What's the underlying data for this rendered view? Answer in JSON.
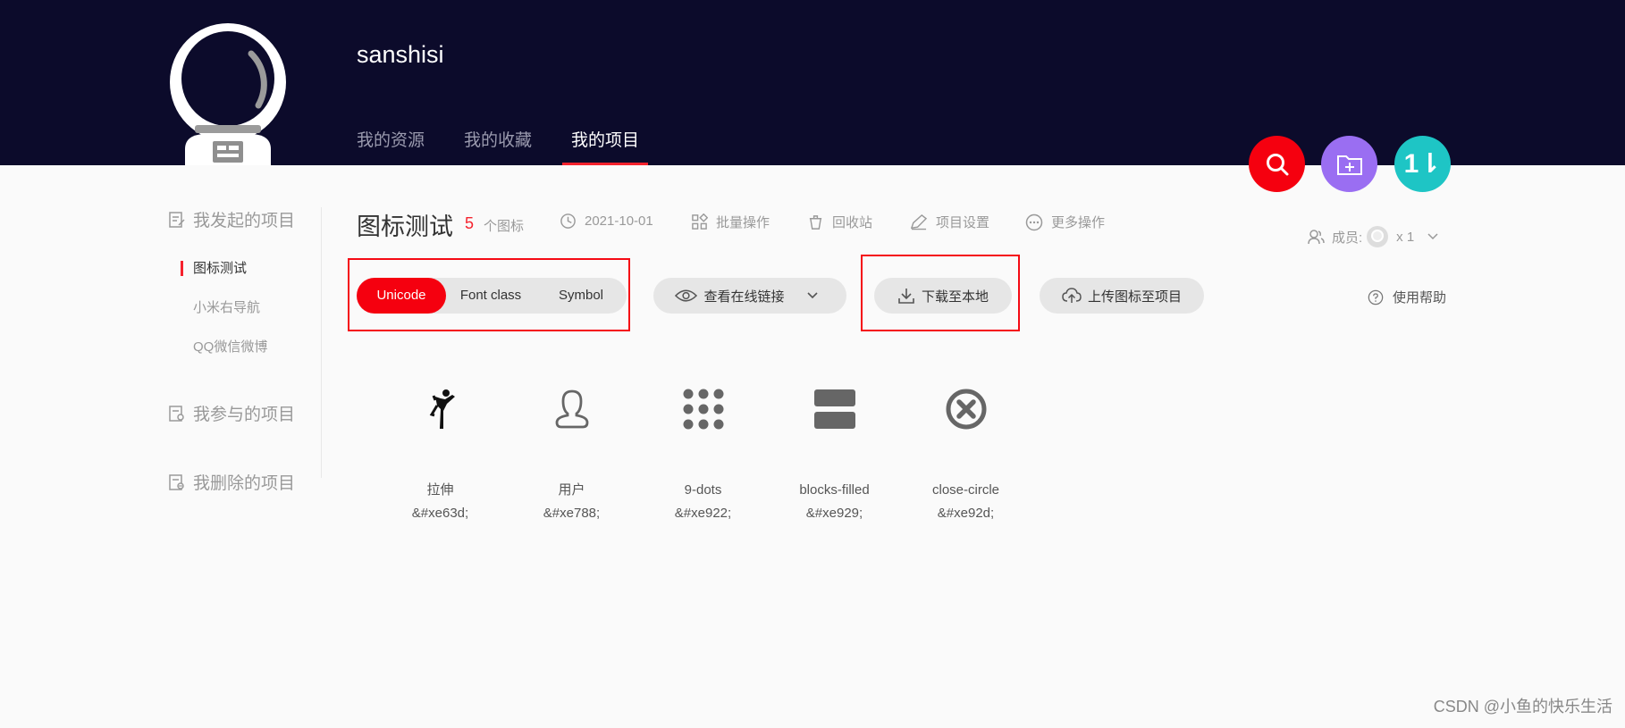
{
  "header": {
    "username": "sanshisi",
    "nav": [
      {
        "label": "我的资源"
      },
      {
        "label": "我的收藏"
      },
      {
        "label": "我的项目"
      }
    ],
    "fab_colors": {
      "search": "#f5000f",
      "folder": "#9a6ef2",
      "sort": "#1ec5c5"
    },
    "sort_label": "1⇂"
  },
  "sidebar": {
    "groups": [
      {
        "label": "我发起的项目",
        "icon": "edit-doc-icon"
      },
      {
        "label": "我参与的项目",
        "icon": "search-doc-icon"
      },
      {
        "label": "我删除的项目",
        "icon": "deleted-doc-icon"
      }
    ],
    "projects": [
      {
        "label": "图标测试"
      },
      {
        "label": "小米右导航"
      },
      {
        "label": "QQ微信微博"
      }
    ]
  },
  "project": {
    "title": "图标测试",
    "icon_count": "5",
    "icon_count_label": "个图标",
    "date": "2021-10-01",
    "batch": "批量操作",
    "trash": "回收站",
    "settings": "项目设置",
    "more": "更多操作",
    "members_label": "成员:",
    "members_count": "x 1",
    "help": "使用帮助"
  },
  "toolbar": {
    "tabs": [
      {
        "label": "Unicode"
      },
      {
        "label": "Font class"
      },
      {
        "label": "Symbol"
      }
    ],
    "view_link": "查看在线链接",
    "download": "下载至本地",
    "upload": "上传图标至项目"
  },
  "icons": [
    {
      "name": "拉伸",
      "code": "&#xe63d;",
      "icon": "stretch-figure-icon"
    },
    {
      "name": "用户",
      "code": "&#xe788;",
      "icon": "user-icon"
    },
    {
      "name": "9-dots",
      "code": "&#xe922;",
      "icon": "nine-dots-icon"
    },
    {
      "name": "blocks-filled",
      "code": "&#xe929;",
      "icon": "blocks-filled-icon"
    },
    {
      "name": "close-circle",
      "code": "&#xe92d;",
      "icon": "close-circle-icon"
    }
  ],
  "watermark": "CSDN @小鱼的快乐生活",
  "accent": "#f5000f"
}
